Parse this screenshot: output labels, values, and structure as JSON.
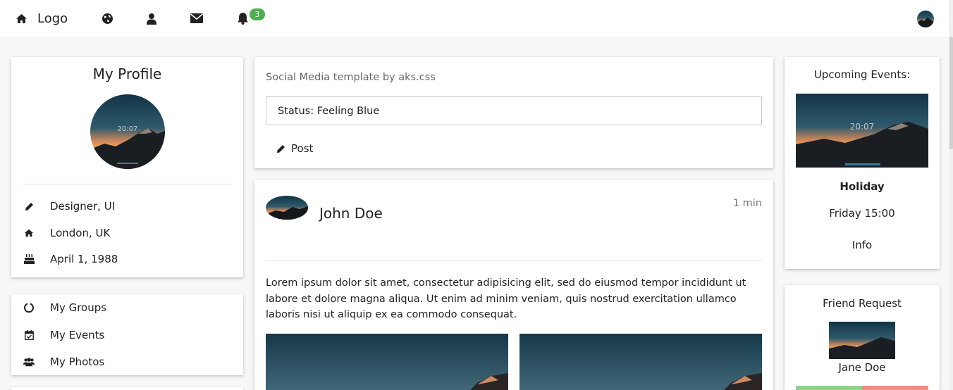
{
  "nav": {
    "logo_text": "Logo",
    "notification_count": "3"
  },
  "profile": {
    "title": "My Profile",
    "occupation": "Designer, UI",
    "location": "London, UK",
    "birthday": "April 1, 1988"
  },
  "menu": {
    "groups": "My Groups",
    "events": "My Events",
    "photos": "My Photos"
  },
  "status": {
    "caption": "Social Media template by aks.css",
    "value": "Status: Feeling Blue",
    "post_label": "Post"
  },
  "post": {
    "author": "John Doe",
    "time": "1 min",
    "text": "Lorem ipsum dolor sit amet, consectetur adipisicing elit, sed do eiusmod tempor incididunt ut labore et dolore magna aliqua. Ut enim ad minim veniam, quis nostrud exercitation ullamco laboris nisi ut aliquip ex ea commodo consequat."
  },
  "events": {
    "title": "Upcoming Events:",
    "image_clock": "20:07",
    "name": "Holiday",
    "when": "Friday 15:00",
    "info": "Info"
  },
  "friend": {
    "title": "Friend Request",
    "name": "Jane Doe"
  },
  "colors": {
    "badge": "#4caf50",
    "accept": "#8fd18f",
    "decline": "#f08b86"
  }
}
